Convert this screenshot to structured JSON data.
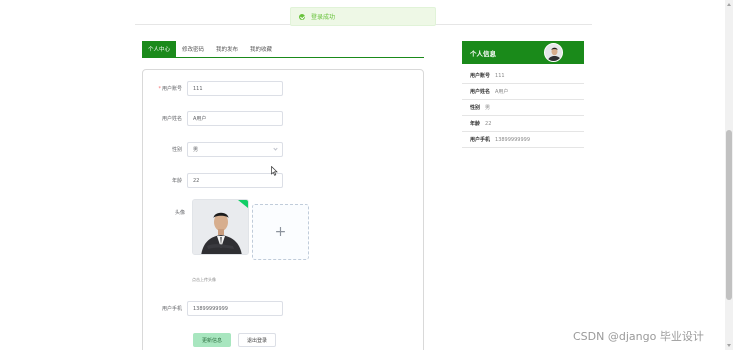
{
  "toast": {
    "message": "登录成功",
    "icon": "success-icon"
  },
  "tabs": [
    {
      "label": "个人中心"
    },
    {
      "label": "修改密码"
    },
    {
      "label": "我的发布"
    },
    {
      "label": "我的收藏"
    }
  ],
  "form": {
    "account": {
      "label": "用户账号",
      "value": "111"
    },
    "name": {
      "label": "用户姓名",
      "value": "A用户"
    },
    "gender": {
      "label": "性别",
      "value": "男"
    },
    "age": {
      "label": "年龄",
      "value": "22"
    },
    "avatar": {
      "label": "头像",
      "hint": "点击上传头像",
      "upload_symbol": "+"
    },
    "phone": {
      "label": "用户手机",
      "value": "13899999999"
    },
    "update_button": "更新信息",
    "logout_button": "退出登录"
  },
  "info_card": {
    "title": "个人信息",
    "rows": [
      {
        "key": "用户账号",
        "value": "111"
      },
      {
        "key": "用户姓名",
        "value": "A用户"
      },
      {
        "key": "性别",
        "value": "男"
      },
      {
        "key": "年龄",
        "value": "22"
      },
      {
        "key": "用户手机",
        "value": "13899999999"
      }
    ]
  },
  "watermark": "CSDN @django 毕业设计",
  "colors": {
    "primary": "#1a8a1a",
    "success": "#67c23a",
    "button_light": "#a8e6bf"
  }
}
